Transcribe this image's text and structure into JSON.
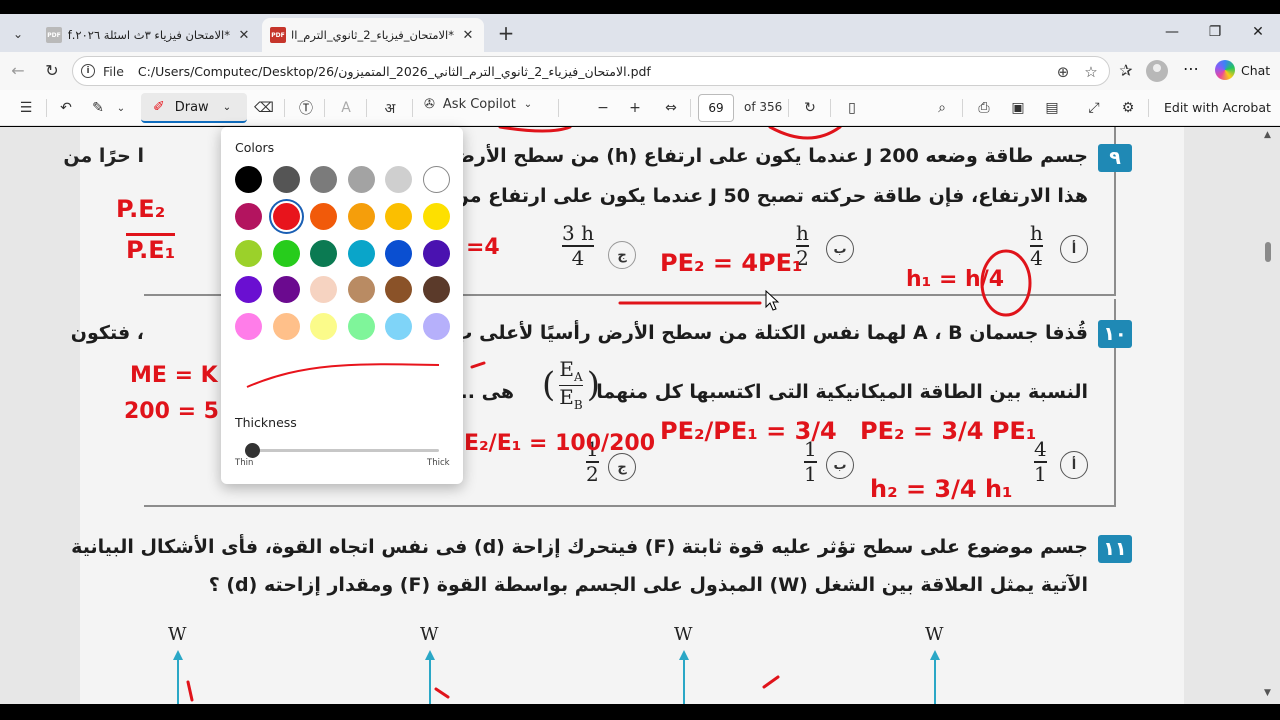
{
  "browser": {
    "tabs": [
      {
        "title": "*الامتحان فيزياء ٣ث اسئلة ٢٠٢٦.pdf",
        "active": false
      },
      {
        "title": "*الامتحان_فيزياء_2_ثانوي_الترم_الثاني",
        "active": true
      }
    ],
    "address": {
      "scheme_label": "File",
      "url": "C:/Users/Computec/Desktop/26/الامتحان_فيزياء_2_ثانوي_الترم_الثاني_2026_المتميزون.pdf"
    },
    "chat_label": "Chat",
    "pdf_badge": "PDF"
  },
  "pdf_toolbar": {
    "draw_label": "Draw",
    "ask_copilot_label": "Ask Copilot",
    "page_current": "69",
    "page_total": "of 356",
    "edit_acrobat_label": "Edit with Acrobat"
  },
  "draw_popup": {
    "colors_heading": "Colors",
    "thickness_heading": "Thickness",
    "thin_label": "Thin",
    "thick_label": "Thick",
    "selected_color": "#e8141c",
    "swatches": [
      [
        "#000000",
        "#555555",
        "#7b7b7b",
        "#a3a3a3",
        "#cfcfcf",
        "#ffffff"
      ],
      [
        "#b3145f",
        "#e8141c",
        "#f15a0a",
        "#f59e0b",
        "#fbbf00",
        "#fde000"
      ],
      [
        "#9bd12a",
        "#27cc1c",
        "#0b7a52",
        "#0aa5c9",
        "#0a4fd1",
        "#4a12b0"
      ],
      [
        "#6a0fd1",
        "#6b0a8f",
        "#f6d3c1",
        "#b98b63",
        "#8a5228",
        "#5b3a2a"
      ],
      [
        "#ff7de9",
        "#ffc08a",
        "#fbfb8a",
        "#7ff59a",
        "#7fd4f8",
        "#b6b0fb"
      ]
    ]
  },
  "document": {
    "q9": {
      "num": "٩",
      "line1": "جسم طاقة وضعه J 200 عندما يكون على ارتفاع (h) من سطح الأرض",
      "line1_tail": "ا حرًا من",
      "line2": "هذا الارتفاع، فإن طاقة حركته تصبح J 50 عندما يكون على ارتفاع من",
      "options": [
        {
          "mark": "أ",
          "num": "h",
          "den": "4"
        },
        {
          "mark": "ب",
          "num": "h",
          "den": "2"
        },
        {
          "mark": "ج",
          "num": "3 h",
          "den": "4"
        }
      ]
    },
    "q10": {
      "num": "١٠",
      "line1": "قُذفا جسمان A ، B لهما نفس الكتلة من سطح الأرض رأسيًا لأعلى ب",
      "line1_tail": "، فتكون",
      "line2_pre": "النسبة بين الطاقة الميكانيكية التى اكتسبها كل منهما",
      "line2_post": "هى ......",
      "ratio_num": "E",
      "ratio_num_sub": "A",
      "ratio_den": "E",
      "ratio_den_sub": "B",
      "options": [
        {
          "mark": "أ",
          "num": "4",
          "den": "1"
        },
        {
          "mark": "ب",
          "num": "1",
          "den": "1"
        },
        {
          "mark": "ج",
          "num": "1",
          "den": "2"
        }
      ]
    },
    "q11": {
      "num": "١١",
      "line1": "جسم موضوع على سطح تؤثر عليه قوة ثابتة (F) فيتحرك إزاحة (d) فى نفس اتجاه القوة، فأى الأشكال البيانية",
      "line2": "الآتية يمثل العلاقة بين الشغل (W) المبذول على الجسم بواسطة القوة (F) ومقدار إزاحته (d) ؟",
      "axis_label": "W"
    },
    "ink_notes": [
      "P.E₂",
      "P.E₁",
      "PE₂ = 4PE₁",
      "h₁ = h/4",
      "PE₂/PE₁ = 3/4",
      "PE₂ = 3/4 PE₁",
      "h₂ = 3/4 h₁",
      "ME = K",
      "200 = 5",
      "E₂/E₁ = 100/200",
      "=4"
    ]
  }
}
